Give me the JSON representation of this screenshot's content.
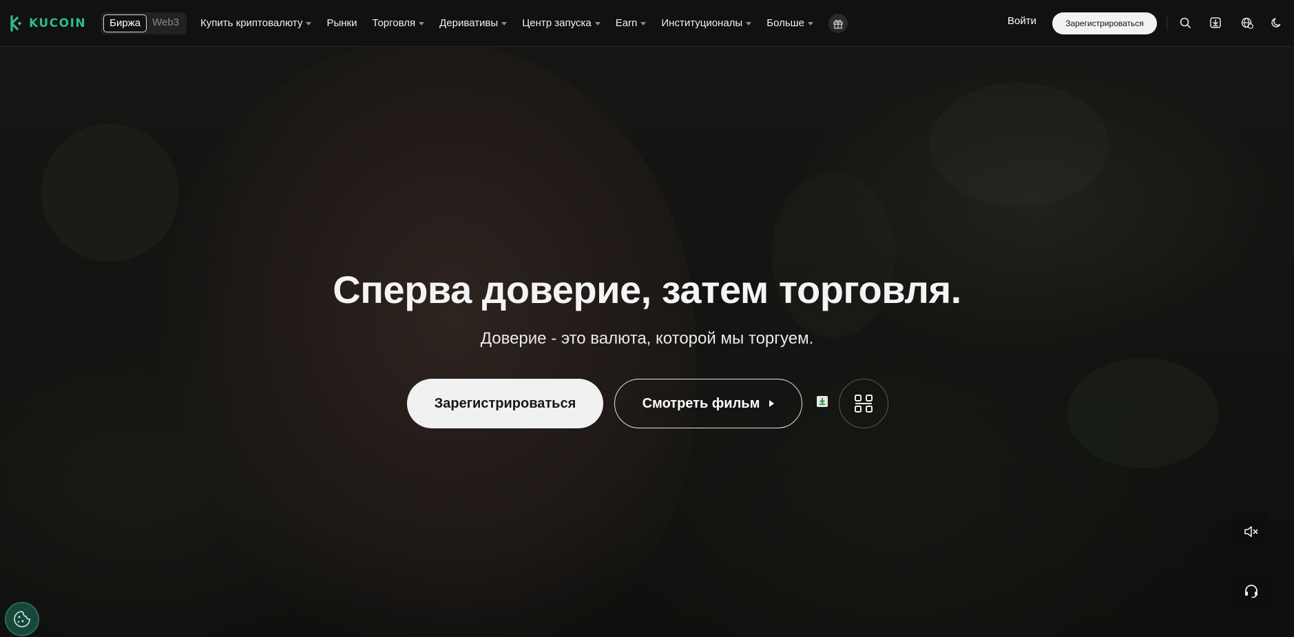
{
  "brand": {
    "name": "KUCOIN",
    "color": "#2dbd85"
  },
  "mode_switch": {
    "exchange_label": "Биржа",
    "web3_label": "Web3",
    "active": "exchange"
  },
  "nav": {
    "items": [
      {
        "label": "Купить криптовалюту",
        "dropdown": true
      },
      {
        "label": "Рынки",
        "dropdown": false
      },
      {
        "label": "Торговля",
        "dropdown": true
      },
      {
        "label": "Деривативы",
        "dropdown": true
      },
      {
        "label": "Центр запуска",
        "dropdown": true
      },
      {
        "label": "Earn",
        "dropdown": true
      },
      {
        "label": "Институционалы",
        "dropdown": true
      },
      {
        "label": "Больше",
        "dropdown": true
      }
    ],
    "gift_icon": "gift-icon"
  },
  "header_actions": {
    "login_label": "Войти",
    "signup_label": "Зарегистрироваться",
    "icons": [
      "search-icon",
      "download-icon",
      "globe-currency-icon",
      "theme-moon-icon"
    ]
  },
  "hero": {
    "headline": "Сперва доверие, затем торговля.",
    "subheadline": "Доверие - это валюта, которой мы торгуем.",
    "primary_cta": "Зарегистрироваться",
    "secondary_cta": "Смотреть фильм",
    "qr_icon": "qr-code-icon"
  },
  "floating": {
    "mute_icon": "sound-muted-icon",
    "support_icon": "headset-support-icon",
    "cookie_icon": "cookie-icon"
  },
  "colors": {
    "topbar_bg": "#111111",
    "primary_btn_bg": "#f1f1f1",
    "accent": "#2dbd85"
  }
}
